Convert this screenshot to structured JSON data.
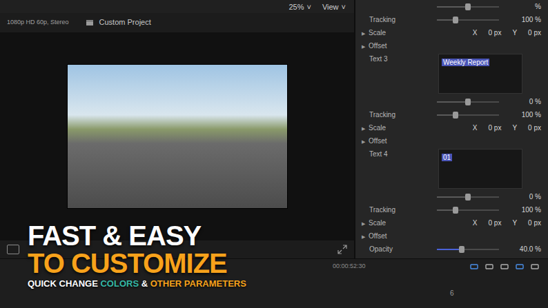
{
  "viewer": {
    "zoom": "25%",
    "zoom_caret": "˅",
    "view": "View",
    "view_caret": "˅",
    "title": "Custom Project",
    "format": "1080p HD 60p, Stereo"
  },
  "inspector": {
    "rows": [
      {
        "kind": "slider",
        "label": "",
        "value": "%",
        "level": 0.5
      },
      {
        "kind": "slider",
        "label": "Tracking",
        "value": "100 %",
        "level": 0.3
      },
      {
        "kind": "xy",
        "expand": "▶",
        "label": "Scale",
        "x_label": "X",
        "x": "0 px",
        "y_label": "Y",
        "y": "0 px"
      },
      {
        "kind": "heading",
        "expand": "▶",
        "label": "Offset"
      },
      {
        "kind": "text",
        "label": "Text 3",
        "value": "Weekly Report",
        "selected": true
      },
      {
        "kind": "slider",
        "label": "",
        "value": "0 %",
        "level": 0.5
      },
      {
        "kind": "slider",
        "label": "Tracking",
        "value": "100 %",
        "level": 0.3
      },
      {
        "kind": "xy",
        "expand": "▶",
        "label": "Scale",
        "x_label": "X",
        "x": "0 px",
        "y_label": "Y",
        "y": "0 px"
      },
      {
        "kind": "heading",
        "expand": "▶",
        "label": "Offset"
      },
      {
        "kind": "text",
        "label": "Text 4",
        "value": "01",
        "selected": true
      },
      {
        "kind": "slider",
        "label": "",
        "value": "0 %",
        "level": 0.5
      },
      {
        "kind": "slider",
        "label": "Tracking",
        "value": "100 %",
        "level": 0.3
      },
      {
        "kind": "xy",
        "expand": "▶",
        "label": "Scale",
        "x_label": "X",
        "x": "0 px",
        "y_label": "Y",
        "y": "0 px"
      },
      {
        "kind": "heading",
        "expand": "▶",
        "label": "Offset"
      },
      {
        "kind": "opacity",
        "label": "Opacity",
        "value": "40.0 %",
        "level": 0.4
      }
    ]
  },
  "timeline": {
    "timecode": "00:00:52:30",
    "track": "6"
  },
  "promo": {
    "lines": [
      {
        "kind": "headline",
        "segments": [
          {
            "text": "FAST & EASY",
            "color": "#ffffff"
          }
        ]
      },
      {
        "kind": "headline",
        "segments": [
          {
            "text": "TO CUSTOMIZE",
            "color": "#f7a21b"
          }
        ]
      },
      {
        "kind": "subline",
        "segments": [
          {
            "text": "QUICK CHANGE ",
            "color": "#ffffff"
          },
          {
            "text": "COLORS",
            "color": "#35b8a6"
          },
          {
            "text": " & ",
            "color": "#ffffff"
          },
          {
            "text": "OTHER PARAMETERS",
            "color": "#f7a21b"
          }
        ]
      }
    ]
  }
}
